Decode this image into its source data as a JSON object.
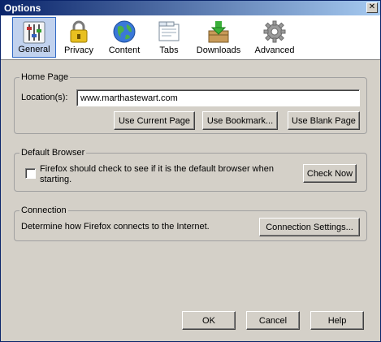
{
  "window": {
    "title": "Options",
    "close_glyph": "✕"
  },
  "toolbar": {
    "panes": [
      {
        "label": "General",
        "icon": "general-sliders-icon",
        "selected": true
      },
      {
        "label": "Privacy",
        "icon": "padlock-icon",
        "selected": false
      },
      {
        "label": "Content",
        "icon": "globe-icon",
        "selected": false
      },
      {
        "label": "Tabs",
        "icon": "tabs-icon",
        "selected": false
      },
      {
        "label": "Downloads",
        "icon": "download-box-icon",
        "selected": false
      },
      {
        "label": "Advanced",
        "icon": "gear-icon",
        "selected": false
      }
    ]
  },
  "home_page": {
    "legend": "Home Page",
    "location_label": "Location(s):",
    "location_value": "www.marthastewart.com",
    "use_current_label": "Use Current Page",
    "use_bookmark_label": "Use Bookmark...",
    "use_blank_label": "Use Blank Page"
  },
  "default_browser": {
    "legend": "Default Browser",
    "check_text": "Firefox should check to see if it is the default browser when starting.",
    "checked": false,
    "check_now_label": "Check Now"
  },
  "connection": {
    "legend": "Connection",
    "description": "Determine how Firefox connects to the Internet.",
    "settings_label": "Connection Settings..."
  },
  "footer": {
    "ok_label": "OK",
    "cancel_label": "Cancel",
    "help_label": "Help"
  },
  "colors": {
    "titlebar_start": "#0a246a",
    "titlebar_end": "#a6caf0",
    "dialog_bg": "#d4d0c8",
    "selected_pane": "#c1d2ee"
  }
}
